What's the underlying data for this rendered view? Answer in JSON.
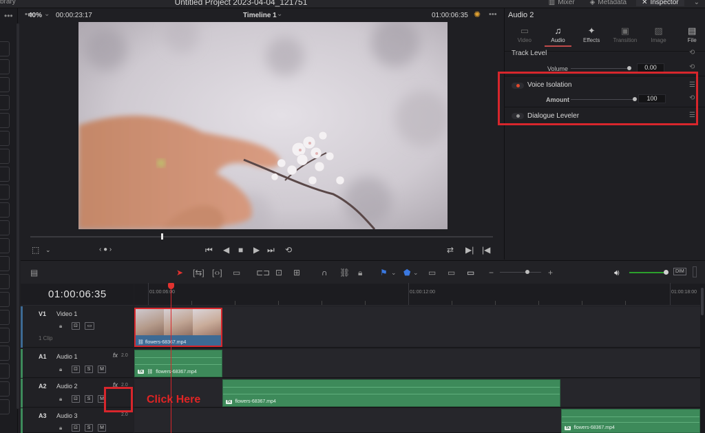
{
  "topbar": {
    "library_label": "brary",
    "project_title": "Untitled Project 2023-04-04_121751",
    "tabs": [
      {
        "label": "Mixer",
        "icon": "mixer-icon"
      },
      {
        "label": "Metadata",
        "icon": "metadata-icon"
      },
      {
        "label": "Inspector",
        "icon": "inspector-icon",
        "active": true
      }
    ]
  },
  "viewer": {
    "zoom": "40%",
    "timecode_left": "00:00:23:17",
    "timeline_name": "Timeline 1",
    "timecode_right": "01:00:06:35"
  },
  "inspector": {
    "title": "Audio 2",
    "tabs": [
      {
        "label": "Video",
        "icon": "video-icon"
      },
      {
        "label": "Audio",
        "icon": "music-note-icon",
        "active": true
      },
      {
        "label": "Effects",
        "icon": "magic-wand-icon"
      },
      {
        "label": "Transition",
        "icon": "transition-icon"
      },
      {
        "label": "Image",
        "icon": "image-icon"
      },
      {
        "label": "File",
        "icon": "file-icon"
      }
    ],
    "track_level": {
      "heading": "Track Level",
      "volume_label": "Volume",
      "volume_value": "0.00"
    },
    "voice_isolation": {
      "label": "Voice Isolation",
      "enabled": true,
      "amount_label": "Amount",
      "amount_value": "100"
    },
    "dialogue_leveler": {
      "label": "Dialogue Leveler",
      "enabled": false
    },
    "colors": {
      "accent": "#d8262c",
      "toggle_on": "#e2492c"
    }
  },
  "timeline": {
    "timecode": "01:00:06:35",
    "ruler_labels": [
      "01:00:06:00",
      "01:00:12:00",
      "01:00:18:00"
    ],
    "tracks": [
      {
        "tag": "V1",
        "name": "Video 1",
        "meta": "1 Clip",
        "kind": "video"
      },
      {
        "tag": "A1",
        "name": "Audio 1",
        "fx": "fx",
        "channels": "2.0",
        "kind": "audio"
      },
      {
        "tag": "A2",
        "name": "Audio 2",
        "fx": "fx",
        "channels": "2.0",
        "kind": "audio"
      },
      {
        "tag": "A3",
        "name": "Audio 3",
        "channels": "2.0",
        "kind": "audio"
      }
    ],
    "buttons": {
      "solo": "S",
      "mute": "M"
    },
    "clips": {
      "v1": "flowers-68367.mp4",
      "a1": "flowers-68367.mp4",
      "a2": "flowers-68367.mp4",
      "a3": "flowers-68367.mp4"
    },
    "fx_badge": "fx",
    "meter_label": "DIM"
  },
  "annotation": {
    "click_here": "Click Here"
  }
}
